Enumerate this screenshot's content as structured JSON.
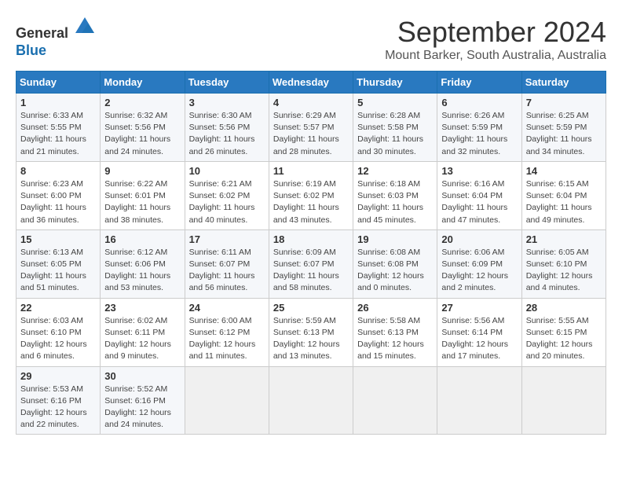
{
  "header": {
    "logo_line1": "General",
    "logo_line2": "Blue",
    "month": "September 2024",
    "location": "Mount Barker, South Australia, Australia"
  },
  "weekdays": [
    "Sunday",
    "Monday",
    "Tuesday",
    "Wednesday",
    "Thursday",
    "Friday",
    "Saturday"
  ],
  "weeks": [
    [
      {
        "day": "1",
        "sunrise": "6:33 AM",
        "sunset": "5:55 PM",
        "daylight": "11 hours and 21 minutes."
      },
      {
        "day": "2",
        "sunrise": "6:32 AM",
        "sunset": "5:56 PM",
        "daylight": "11 hours and 24 minutes."
      },
      {
        "day": "3",
        "sunrise": "6:30 AM",
        "sunset": "5:56 PM",
        "daylight": "11 hours and 26 minutes."
      },
      {
        "day": "4",
        "sunrise": "6:29 AM",
        "sunset": "5:57 PM",
        "daylight": "11 hours and 28 minutes."
      },
      {
        "day": "5",
        "sunrise": "6:28 AM",
        "sunset": "5:58 PM",
        "daylight": "11 hours and 30 minutes."
      },
      {
        "day": "6",
        "sunrise": "6:26 AM",
        "sunset": "5:59 PM",
        "daylight": "11 hours and 32 minutes."
      },
      {
        "day": "7",
        "sunrise": "6:25 AM",
        "sunset": "5:59 PM",
        "daylight": "11 hours and 34 minutes."
      }
    ],
    [
      {
        "day": "8",
        "sunrise": "6:23 AM",
        "sunset": "6:00 PM",
        "daylight": "11 hours and 36 minutes."
      },
      {
        "day": "9",
        "sunrise": "6:22 AM",
        "sunset": "6:01 PM",
        "daylight": "11 hours and 38 minutes."
      },
      {
        "day": "10",
        "sunrise": "6:21 AM",
        "sunset": "6:02 PM",
        "daylight": "11 hours and 40 minutes."
      },
      {
        "day": "11",
        "sunrise": "6:19 AM",
        "sunset": "6:02 PM",
        "daylight": "11 hours and 43 minutes."
      },
      {
        "day": "12",
        "sunrise": "6:18 AM",
        "sunset": "6:03 PM",
        "daylight": "11 hours and 45 minutes."
      },
      {
        "day": "13",
        "sunrise": "6:16 AM",
        "sunset": "6:04 PM",
        "daylight": "11 hours and 47 minutes."
      },
      {
        "day": "14",
        "sunrise": "6:15 AM",
        "sunset": "6:04 PM",
        "daylight": "11 hours and 49 minutes."
      }
    ],
    [
      {
        "day": "15",
        "sunrise": "6:13 AM",
        "sunset": "6:05 PM",
        "daylight": "11 hours and 51 minutes."
      },
      {
        "day": "16",
        "sunrise": "6:12 AM",
        "sunset": "6:06 PM",
        "daylight": "11 hours and 53 minutes."
      },
      {
        "day": "17",
        "sunrise": "6:11 AM",
        "sunset": "6:07 PM",
        "daylight": "11 hours and 56 minutes."
      },
      {
        "day": "18",
        "sunrise": "6:09 AM",
        "sunset": "6:07 PM",
        "daylight": "11 hours and 58 minutes."
      },
      {
        "day": "19",
        "sunrise": "6:08 AM",
        "sunset": "6:08 PM",
        "daylight": "12 hours and 0 minutes."
      },
      {
        "day": "20",
        "sunrise": "6:06 AM",
        "sunset": "6:09 PM",
        "daylight": "12 hours and 2 minutes."
      },
      {
        "day": "21",
        "sunrise": "6:05 AM",
        "sunset": "6:10 PM",
        "daylight": "12 hours and 4 minutes."
      }
    ],
    [
      {
        "day": "22",
        "sunrise": "6:03 AM",
        "sunset": "6:10 PM",
        "daylight": "12 hours and 6 minutes."
      },
      {
        "day": "23",
        "sunrise": "6:02 AM",
        "sunset": "6:11 PM",
        "daylight": "12 hours and 9 minutes."
      },
      {
        "day": "24",
        "sunrise": "6:00 AM",
        "sunset": "6:12 PM",
        "daylight": "12 hours and 11 minutes."
      },
      {
        "day": "25",
        "sunrise": "5:59 AM",
        "sunset": "6:13 PM",
        "daylight": "12 hours and 13 minutes."
      },
      {
        "day": "26",
        "sunrise": "5:58 AM",
        "sunset": "6:13 PM",
        "daylight": "12 hours and 15 minutes."
      },
      {
        "day": "27",
        "sunrise": "5:56 AM",
        "sunset": "6:14 PM",
        "daylight": "12 hours and 17 minutes."
      },
      {
        "day": "28",
        "sunrise": "5:55 AM",
        "sunset": "6:15 PM",
        "daylight": "12 hours and 20 minutes."
      }
    ],
    [
      {
        "day": "29",
        "sunrise": "5:53 AM",
        "sunset": "6:16 PM",
        "daylight": "12 hours and 22 minutes."
      },
      {
        "day": "30",
        "sunrise": "5:52 AM",
        "sunset": "6:16 PM",
        "daylight": "12 hours and 24 minutes."
      },
      null,
      null,
      null,
      null,
      null
    ]
  ],
  "labels": {
    "sunrise": "Sunrise: ",
    "sunset": "Sunset: ",
    "daylight": "Daylight: "
  }
}
